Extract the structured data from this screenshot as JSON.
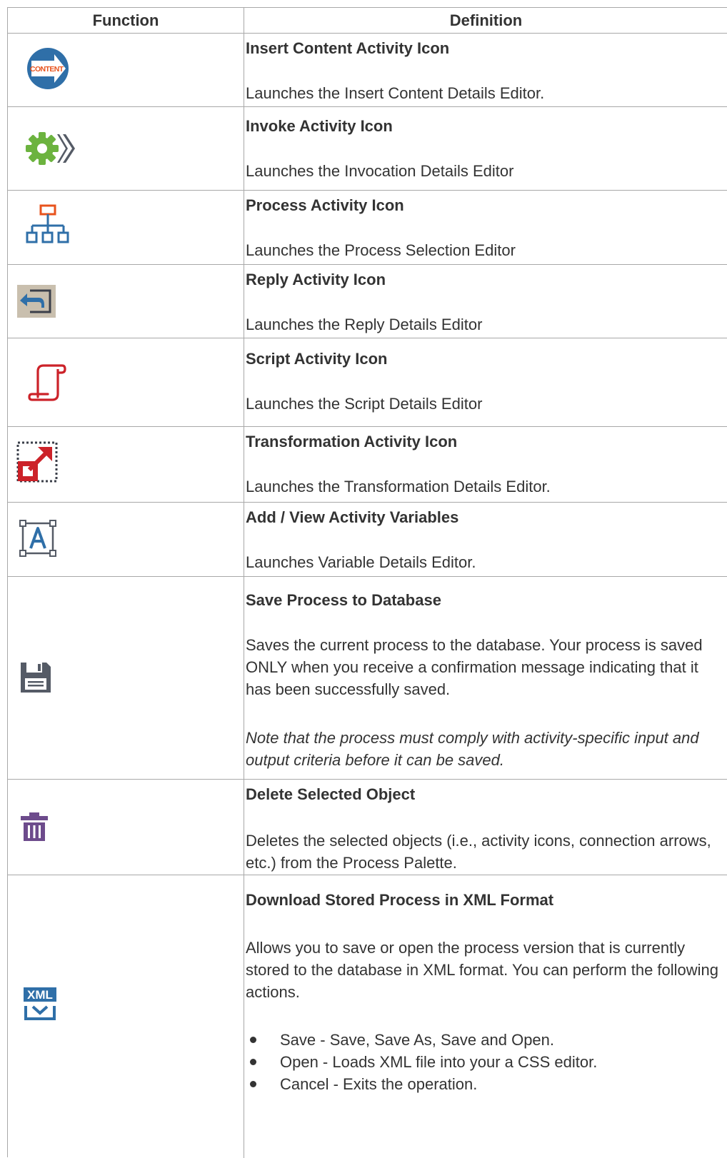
{
  "header": {
    "function": "Function",
    "definition": "Definition"
  },
  "rows": [
    {
      "icon": "content-arrow-icon",
      "title": "Insert Content Activity Icon",
      "desc": "Launches the Insert Content Details Editor.",
      "icon_text": "CONTENT"
    },
    {
      "icon": "invoke-gear-icon",
      "title": "Invoke Activity Icon",
      "desc": "Launches the Invocation Details Editor"
    },
    {
      "icon": "process-hierarchy-icon",
      "title": "Process Activity Icon",
      "desc": "Launches the Process Selection Editor"
    },
    {
      "icon": "reply-arrow-icon",
      "title": "Reply Activity Icon",
      "desc": "Launches the Reply Details Editor"
    },
    {
      "icon": "script-scroll-icon",
      "title": "Script Activity Icon",
      "desc": "Launches the Script Details Editor"
    },
    {
      "icon": "transformation-icon",
      "title": "Transformation Activity Icon",
      "desc": "Launches the Transformation Details Editor."
    },
    {
      "icon": "variables-icon",
      "title": "Add / View Activity Variables",
      "desc": "Launches Variable Details Editor."
    },
    {
      "icon": "save-disk-icon",
      "title": "Save Process to Database",
      "desc": "Saves the current process to the database. Your process is saved ONLY when you receive a confirmation message indicating that it has been successfully saved.",
      "note": "Note that the process must comply with activity-specific input and output criteria before it can be saved."
    },
    {
      "icon": "trash-icon",
      "title": "Delete Selected Object",
      "desc": "Deletes the selected objects (i.e., activity icons, connection arrows, etc.) from the Process Palette."
    },
    {
      "icon": "xml-download-icon",
      "title": "Download Stored Process in XML Format",
      "desc": "Allows you to save or open the process version that is currently stored to the database in XML format. You can perform the following actions.",
      "icon_text": "XML",
      "bullets": [
        "Save - Save, Save As, Save and Open.",
        "Open - Loads XML file into your a CSS editor.",
        "Cancel - Exits the operation."
      ]
    }
  ],
  "colors": {
    "border": "#a8a8a8",
    "text": "#333333",
    "blue": "#2f6fa8",
    "green": "#6cb33f",
    "red": "#cc2229",
    "orange": "#e8531d",
    "purple": "#6d4b8c",
    "gray": "#555b66"
  }
}
